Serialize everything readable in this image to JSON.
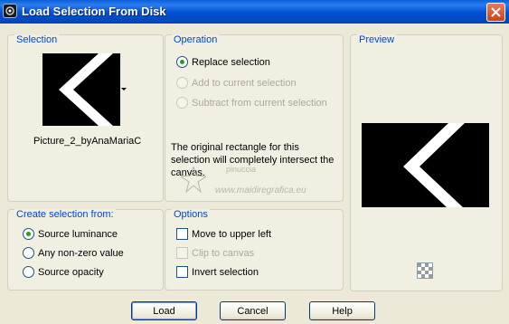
{
  "window": {
    "title": "Load Selection From Disk"
  },
  "selection_group": {
    "title": "Selection",
    "file_name": "Picture_2_byAnaMariaC"
  },
  "operation_group": {
    "title": "Operation",
    "options": [
      {
        "label": "Replace selection",
        "checked": true,
        "enabled": true
      },
      {
        "label": "Add to current selection",
        "checked": false,
        "enabled": false
      },
      {
        "label": "Subtract from current selection",
        "checked": false,
        "enabled": false
      }
    ],
    "note": "The original rectangle for this selection will completely intersect the canvas."
  },
  "preview_group": {
    "title": "Preview"
  },
  "create_group": {
    "title": "Create selection from:",
    "options": [
      {
        "label": "Source luminance",
        "checked": true
      },
      {
        "label": "Any non-zero value",
        "checked": false
      },
      {
        "label": "Source opacity",
        "checked": false
      }
    ]
  },
  "options_group": {
    "title": "Options",
    "checks": [
      {
        "label": "Move to upper left",
        "checked": false,
        "enabled": true
      },
      {
        "label": "Clip to canvas",
        "checked": false,
        "enabled": false
      },
      {
        "label": "Invert selection",
        "checked": false,
        "enabled": true
      }
    ]
  },
  "buttons": {
    "load": "Load",
    "cancel": "Cancel",
    "help": "Help"
  },
  "watermark": {
    "line1": "pinuccia",
    "line2": "www.maidiregrafica.eu"
  },
  "colors": {
    "titlebar": "#0050d0",
    "group_title": "#0046d5",
    "dialog_bg": "#ece9d8"
  }
}
